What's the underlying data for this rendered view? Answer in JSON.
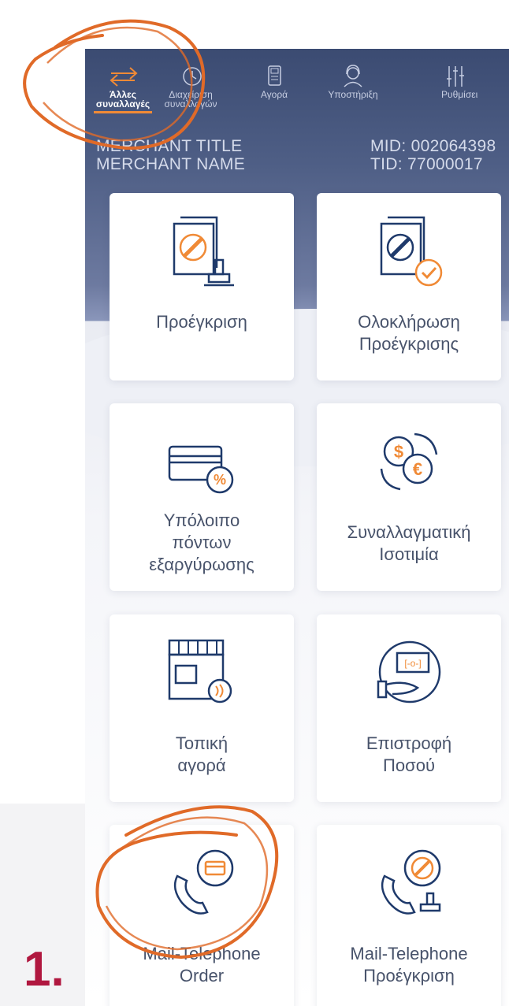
{
  "nav": {
    "items": [
      {
        "line1": "Άλλες",
        "line2": "συναλλαγές",
        "active": true,
        "icon": "swap-arrows-icon"
      },
      {
        "line1": "Διαχείριση",
        "line2": "συναλλαγών",
        "active": false,
        "icon": "clock-icon"
      },
      {
        "line1": "Αγορά",
        "line2": "",
        "active": false,
        "icon": "pos-terminal-icon"
      },
      {
        "line1": "Υποστήριξη",
        "line2": "",
        "active": false,
        "icon": "support-agent-icon"
      },
      {
        "line1": "Ρυθμίσει",
        "line2": "",
        "active": false,
        "icon": "sliders-icon"
      }
    ]
  },
  "merchant": {
    "title": "MERCHANT TITLE",
    "name": "MERCHANT NAME",
    "mid": "MID: 002064398",
    "tid": "TID: 77000017"
  },
  "tiles": [
    {
      "icon": "preauthorization-document-stamp-icon",
      "lines": [
        "Προέγκριση"
      ]
    },
    {
      "icon": "preauthorization-complete-icon",
      "lines": [
        "Ολοκλήρωση",
        "Προέγκρισης"
      ]
    },
    {
      "icon": "card-points-balance-icon",
      "lines": [
        "Υπόλοιπο",
        "πόντων",
        "εξαργύρωσης"
      ]
    },
    {
      "icon": "currency-exchange-icon",
      "lines": [
        "Συναλλαγματική",
        "Ισοτιμία"
      ]
    },
    {
      "icon": "local-store-contactless-icon",
      "lines": [
        "Τοπική",
        "αγορά"
      ]
    },
    {
      "icon": "refund-hand-icon",
      "lines": [
        "Επιστροφή",
        "Ποσού"
      ]
    },
    {
      "icon": "mail-telephone-order-icon",
      "lines": [
        "Mail-Telephone",
        "Order"
      ]
    },
    {
      "icon": "mail-telephone-preauth-icon",
      "lines": [
        "Mail-Telephone",
        "Προέγκριση"
      ]
    }
  ],
  "step_label": "1.",
  "colors": {
    "navy": "#1f3a6b",
    "orange": "#f08a36",
    "step": "#b0173f"
  }
}
